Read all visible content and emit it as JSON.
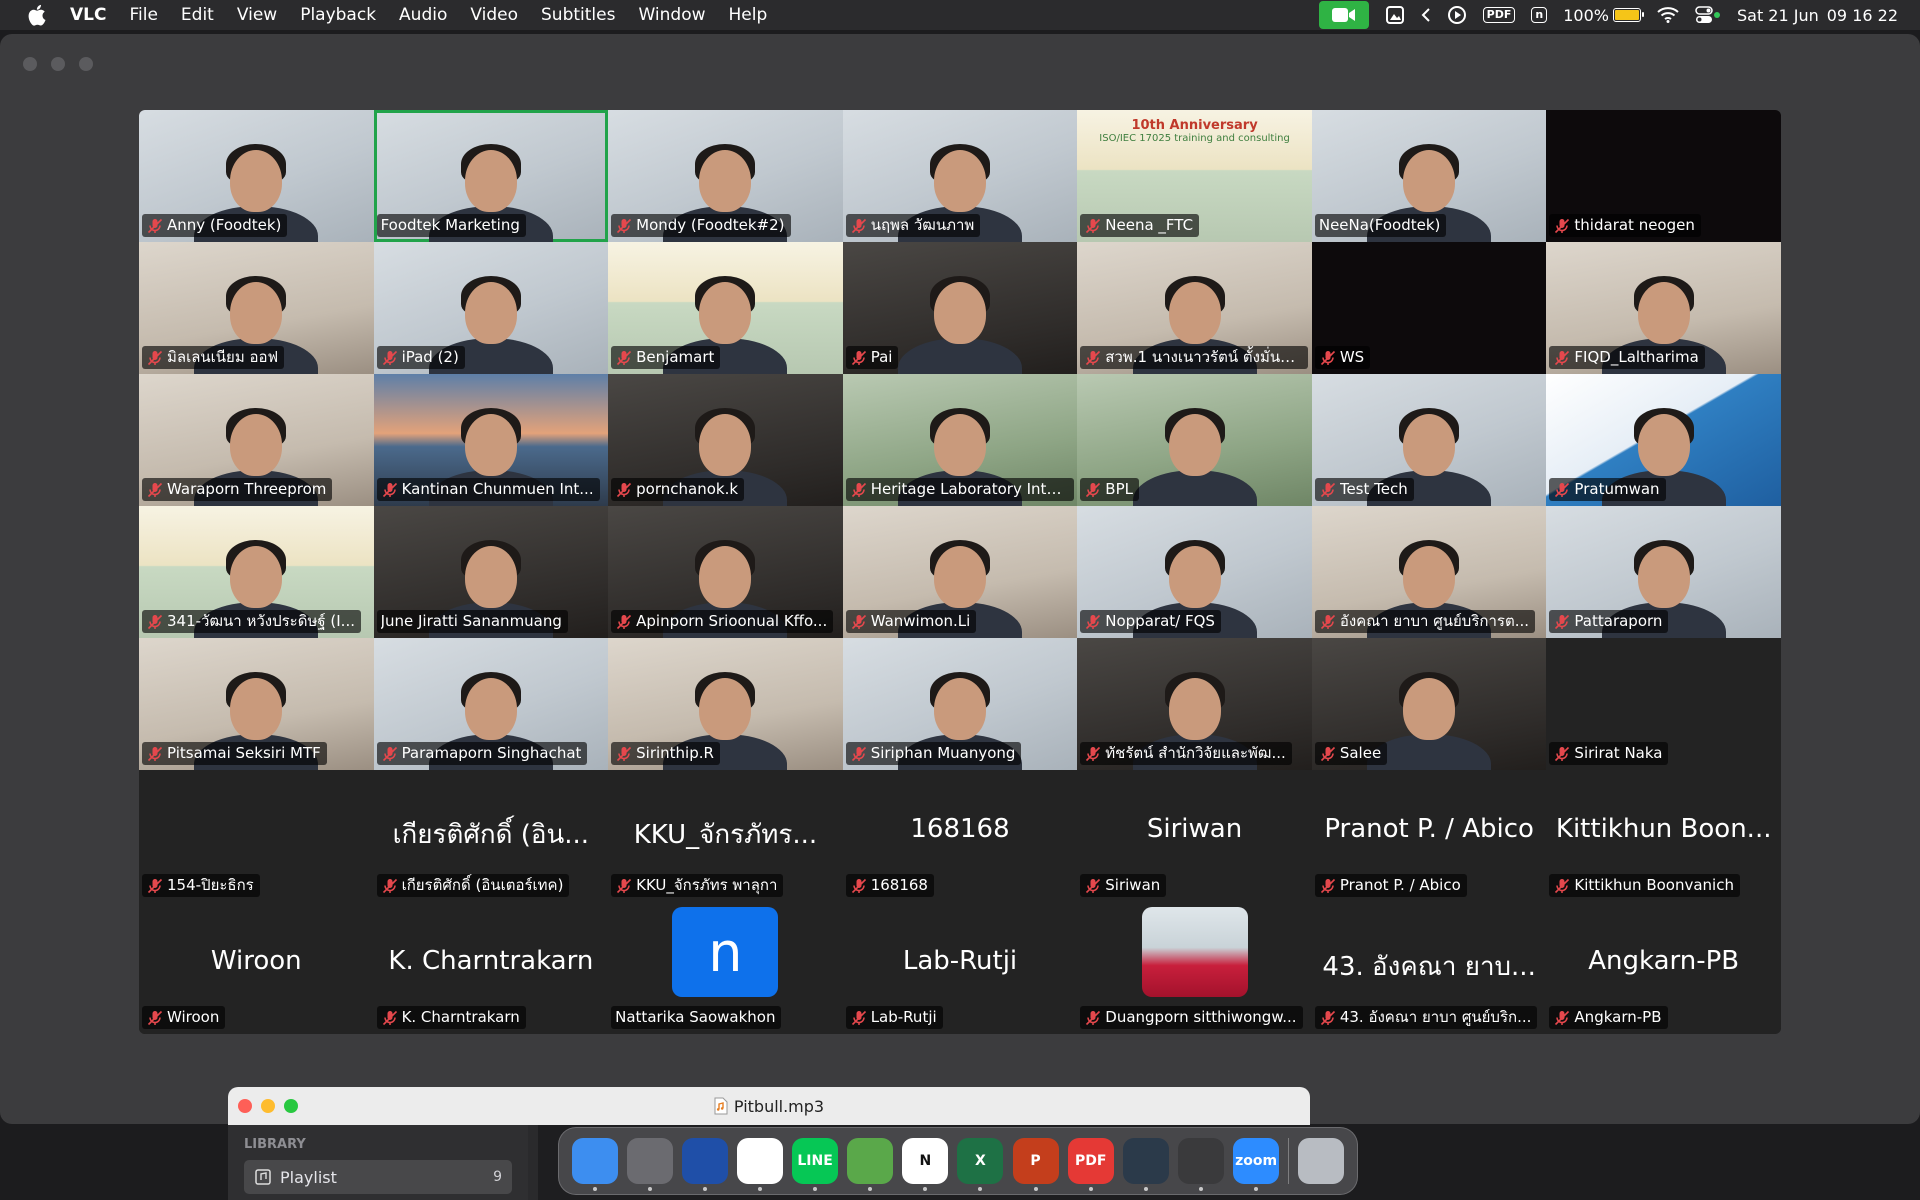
{
  "menubar": {
    "app_name": "VLC",
    "items": [
      "File",
      "Edit",
      "View",
      "Playback",
      "Audio",
      "Video",
      "Subtitles",
      "Window",
      "Help"
    ],
    "status": {
      "pdf_label": "PDF",
      "n_label": "n",
      "battery": "100%",
      "battery_level": 1.0,
      "date": "Sat 21 Jun",
      "time": "09 16 22"
    }
  },
  "meeting": {
    "participants": [
      {
        "name": "Anny (Foodtek)",
        "muted": true,
        "video": true
      },
      {
        "name": "Foodtek Marketing",
        "muted": false,
        "video": true,
        "active": true
      },
      {
        "name": "Mondy (Foodtek#2)",
        "muted": true,
        "video": true
      },
      {
        "name": "นฤพล วัฒนภาพ",
        "muted": true,
        "video": true
      },
      {
        "name": "Neena _FTC",
        "muted": true,
        "video": true,
        "banner_top": "10th Anniversary",
        "banner": "ISO/IEC 17025 training and consulting"
      },
      {
        "name": "NeeNa(Foodtek)",
        "muted": false,
        "video": true
      },
      {
        "name": "thidarat neogen",
        "muted": true,
        "video": true,
        "black": true
      },
      {
        "name": "มิลเลนเนียม ออฟ",
        "muted": true,
        "video": true
      },
      {
        "name": "iPad (2)",
        "muted": true,
        "video": true
      },
      {
        "name": "Benjamart",
        "muted": true,
        "video": true
      },
      {
        "name": "Pai",
        "muted": true,
        "video": true
      },
      {
        "name": "สวพ.1 นางเนาวรัตน์ ตั้งมั่นค...",
        "muted": true,
        "video": true
      },
      {
        "name": "WS",
        "muted": true,
        "video": true,
        "black": true
      },
      {
        "name": "FIQD_Laltharima",
        "muted": true,
        "video": true
      },
      {
        "name": "Waraporn Threeprom",
        "muted": true,
        "video": true
      },
      {
        "name": "Kantinan Chunmuen Int...",
        "muted": true,
        "video": true
      },
      {
        "name": "pornchanok.k",
        "muted": true,
        "video": true
      },
      {
        "name": "Heritage Laboratory Inte...",
        "muted": true,
        "video": true
      },
      {
        "name": "BPL",
        "muted": true,
        "video": true
      },
      {
        "name": "Test Tech",
        "muted": true,
        "video": true
      },
      {
        "name": "Pratumwan",
        "muted": true,
        "video": true
      },
      {
        "name": "341-วัฒนา หวังประดิษฐ์ (I...",
        "muted": true,
        "video": true
      },
      {
        "name": "June Jiratti Sananmuang",
        "muted": false,
        "video": true
      },
      {
        "name": "Apinporn Srioonual  Kffo...",
        "muted": true,
        "video": true
      },
      {
        "name": "Wanwimon.Li",
        "muted": true,
        "video": true
      },
      {
        "name": "Nopparat/ FQS",
        "muted": true,
        "video": true
      },
      {
        "name": "อังคณา ยาบา ศูนย์บริการต...",
        "muted": true,
        "video": true
      },
      {
        "name": "Pattaraporn",
        "muted": true,
        "video": true
      },
      {
        "name": "Pitsamai Seksiri MTF",
        "muted": true,
        "video": true
      },
      {
        "name": "Paramaporn Singhachat",
        "muted": true,
        "video": true
      },
      {
        "name": "Sirinthip.R",
        "muted": true,
        "video": true
      },
      {
        "name": "Siriphan Muanyong",
        "muted": true,
        "video": true
      },
      {
        "name": "ทัชรัตน์  สำนักวิจัยและพัฒ...",
        "muted": true,
        "video": true
      },
      {
        "name": "Salee",
        "muted": true,
        "video": true
      },
      {
        "name": "Sirirat Naka",
        "muted": true,
        "video": false,
        "big": ""
      },
      {
        "name": "154-ปิยะธิกร",
        "muted": true,
        "video": false,
        "big": ""
      },
      {
        "name": "เกียรติศักดิ์  (อินเตอร์เทค)",
        "muted": true,
        "video": false,
        "big": "เกียรติศักดิ์  (อิน..."
      },
      {
        "name": "KKU_จักรภัทร พาลุกา",
        "muted": true,
        "video": false,
        "big": "KKU_จักรภัทร..."
      },
      {
        "name": "168168",
        "muted": true,
        "video": false,
        "big": "168168"
      },
      {
        "name": "Siriwan",
        "muted": true,
        "video": false,
        "big": "Siriwan"
      },
      {
        "name": "Pranot P. / Abico",
        "muted": true,
        "video": false,
        "big": "Pranot P. / Abico"
      },
      {
        "name": "Kittikhun Boonvanich",
        "muted": true,
        "video": false,
        "big": "Kittikhun Boon..."
      },
      {
        "name": "Wiroon",
        "muted": true,
        "video": false,
        "big": "Wiroon"
      },
      {
        "name": "K. Charntrakarn",
        "muted": true,
        "video": false,
        "big": "K. Charntrakarn"
      },
      {
        "name": "Nattarika Saowakhon",
        "muted": false,
        "video": false,
        "avatar_letter": "n"
      },
      {
        "name": "Lab-Rutji",
        "muted": true,
        "video": false,
        "big": "Lab-Rutji"
      },
      {
        "name": "Duangporn sitthiwongw...",
        "muted": true,
        "video": false,
        "avatar_photo": true
      },
      {
        "name": "43. อังคณา ยาบา ศูนย์บริก...",
        "muted": true,
        "video": false,
        "big": "43. อังคณา ยาบ..."
      },
      {
        "name": "Angkarn-PB",
        "muted": true,
        "video": false,
        "big": "Angkarn-PB"
      }
    ]
  },
  "playlist_window": {
    "title": "Pitbull.mp3",
    "library_label": "LIBRARY",
    "playlist_label": "Playlist",
    "playlist_count": "9"
  },
  "dock": {
    "apps": [
      {
        "icon": "finder-icon",
        "color": "#3d8ef0"
      },
      {
        "icon": "launchpad-icon",
        "color": "#6b6b70"
      },
      {
        "icon": "firefox-icon",
        "color": "#1f4fa8"
      },
      {
        "icon": "chrome-icon",
        "color": "#ffffff"
      },
      {
        "icon": "line-icon",
        "color": "#06c755",
        "label": "LINE"
      },
      {
        "icon": "pencil-icon",
        "color": "#5aa84a"
      },
      {
        "icon": "notion-icon",
        "color": "#ffffff",
        "label": "N"
      },
      {
        "icon": "excel-icon",
        "color": "#1e7145",
        "label": "X"
      },
      {
        "icon": "powerpoint-icon",
        "color": "#c43e1c",
        "label": "P"
      },
      {
        "icon": "pdf-expert-icon",
        "color": "#e53935",
        "label": "PDF"
      },
      {
        "icon": "quicktime-icon",
        "color": "#2b3a4a"
      },
      {
        "icon": "vlc-icon",
        "color": "#3a3a3c"
      },
      {
        "icon": "zoom-icon",
        "color": "#2d8cff",
        "label": "zoom"
      },
      {
        "icon": "trash-icon",
        "color": "#b8bcc2"
      }
    ]
  }
}
